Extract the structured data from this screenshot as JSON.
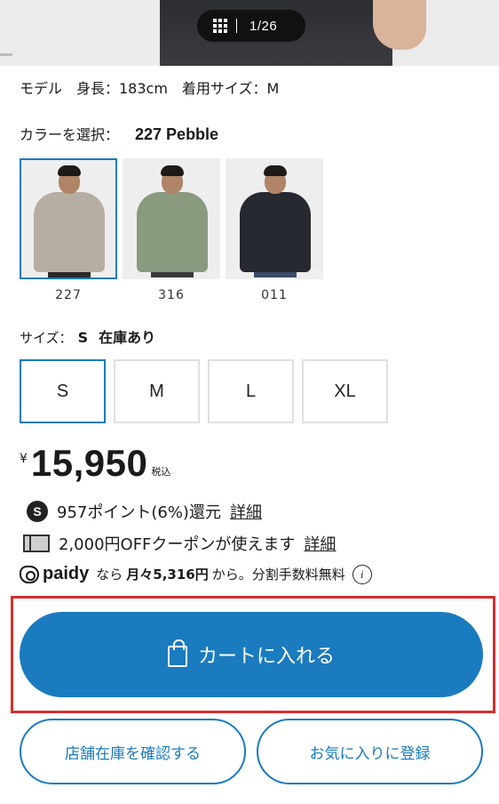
{
  "gallery": {
    "counter": "1/26"
  },
  "model_info": "モデル　身長：183cm　着用サイズ：M",
  "color": {
    "label": "カラーを選択：",
    "selected": "227 Pebble",
    "options": [
      {
        "code": "227",
        "jacket_color": "#b7aea3",
        "legs_color": "#2a2a2a"
      },
      {
        "code": "316",
        "jacket_color": "#8a9a7e",
        "legs_color": "#3a3a3a"
      },
      {
        "code": "011",
        "jacket_color": "#26292f",
        "legs_color": "#3b4a66"
      }
    ]
  },
  "size": {
    "label": "サイズ：",
    "selected": "S",
    "stock": "在庫あり",
    "options": [
      "S",
      "M",
      "L",
      "XL"
    ]
  },
  "price": {
    "currency": "¥",
    "amount": "15,950",
    "tax": "税込"
  },
  "points": {
    "icon": "S",
    "text": "957ポイント(6%)還元",
    "link": "詳細"
  },
  "coupon": {
    "text": "2,000円OFFクーポンが使えます",
    "link": "詳細"
  },
  "paidy": {
    "logo": "paidy",
    "prefix": "なら",
    "monthly": "月々5,316円",
    "suffix": "から。分割手数料無料",
    "info": "i"
  },
  "buttons": {
    "cart": "カートに入れる",
    "store_stock": "店舗在庫を確認する",
    "favorite": "お気に入りに登録"
  }
}
